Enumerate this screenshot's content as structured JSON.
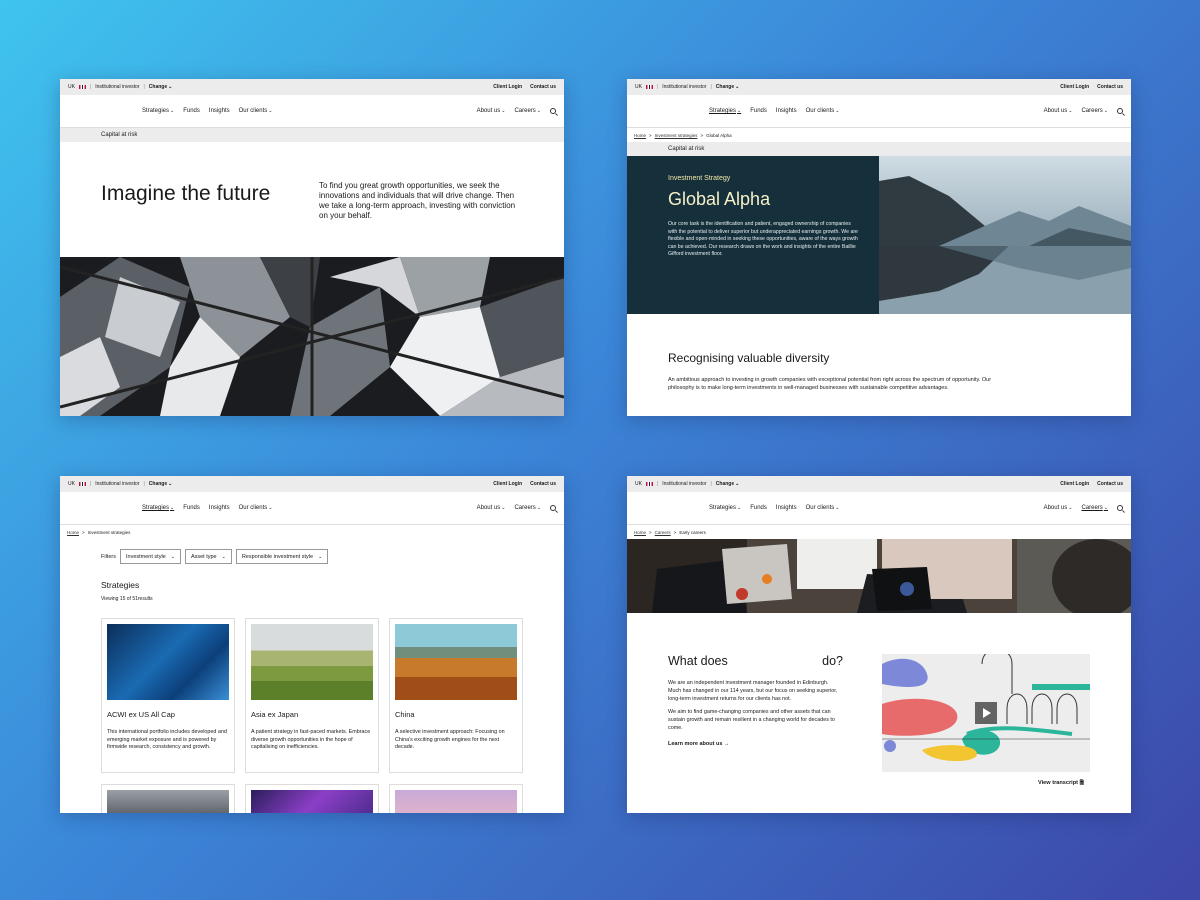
{
  "common": {
    "region": "UK",
    "investor": "Institutional investor",
    "change": "Change",
    "client_login": "Client Login",
    "contact_us": "Contact us",
    "nav": {
      "strategies": "Strategies",
      "funds": "Funds",
      "insights": "Insights",
      "our_clients": "Our clients",
      "about_us": "About us",
      "careers": "Careers"
    },
    "capital_at_risk": "Capital at risk",
    "home": "Home"
  },
  "card1": {
    "heading": "Imagine the future",
    "intro": "To find you great growth opportunities, we seek the innovations and individuals that will drive change. Then we take a long-term approach, investing with conviction on your behalf."
  },
  "card2": {
    "crumb_investment_strategies": "Investment strategies",
    "crumb_current": "Global Alpha",
    "eyebrow": "Investment Strategy",
    "title": "Global Alpha",
    "description": "Our core task is the identification and patient, engaged ownership of companies with the potential to deliver superior but underappreciated earnings growth. We are flexible and open-minded in seeking these opportunities, aware of the ways growth can be achieved. Our research draws on the work and insights of the entire Baillie Gifford investment floor.",
    "section_title": "Recognising valuable diversity",
    "section_text": "An ambitious approach to investing in growth companies with exceptional potential from right across the spectrum of opportunity. Our philosophy is to make long-term investments in well-managed businesses with sustainable competitive advantages."
  },
  "card3": {
    "crumb_current": "Investment strategies",
    "filters_label": "Filters",
    "filter_style": "Investment style",
    "filter_asset": "Asset type",
    "filter_responsible": "Responsible investment style",
    "title": "Strategies",
    "count": "Viewing 15 of 51results",
    "strategies": [
      {
        "title": "ACWI ex US All Cap",
        "desc": "This international portfolio includes developed and emerging market exposure and is powered by firmwide research, consistency and growth."
      },
      {
        "title": "Asia ex Japan",
        "desc": "A patient strategy in fast-paced markets. Embrace diverse growth opportunities in the hope of capitalising on inefficiencies."
      },
      {
        "title": "China",
        "desc": "A selective investment approach: Focusing on China's exciting growth engines for the next decade."
      }
    ]
  },
  "card4": {
    "crumb_careers": "Careers",
    "crumb_current": "Early careers",
    "title_start": "What does",
    "title_end": "do?",
    "p1": "We are an independent investment manager founded in Edinburgh. Much has changed in our 114 years, but our focus on seeking superior, long-term investment returns for our clients has not.",
    "p2": "We aim to find game-changing companies and other assets that can sustain growth and remain resilient in a changing world for decades to come.",
    "learn_more": "Learn more about us",
    "transcript": "View transcript"
  }
}
